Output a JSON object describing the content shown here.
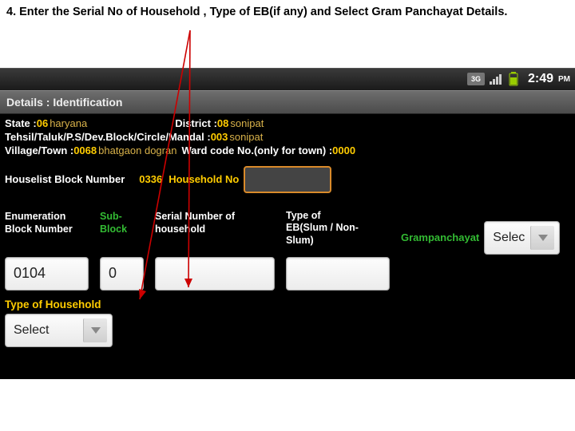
{
  "instruction": "4. Enter the Serial No of Household , Type of EB(if any) and Select Gram Panchayat Details.",
  "status": {
    "time": "2:49",
    "ampm": "PM",
    "net": "3G"
  },
  "title": "Details : Identification",
  "loc": {
    "state_label": "State : ",
    "state_code": "06",
    "state_name": "haryana",
    "district_label": "District : ",
    "district_code": "08",
    "district_name": "sonipat",
    "tehsil_label": "Tehsil/Taluk/P.S/Dev.Block/Circle/Mandal : ",
    "tehsil_code": "003",
    "tehsil_name": "sonipat",
    "village_label": "Village/Town : ",
    "village_code": "0068",
    "village_name": "bhatgaon dogran",
    "ward_label": "Ward code No.(only for town) : ",
    "ward_code": "0000",
    "hlb_label": "Houselist Block Number",
    "hlb_code": "0336",
    "hhno_label": "Household No"
  },
  "cols": {
    "enum_label1": "Enumeration",
    "enum_label2": "Block Number",
    "enum_value": "0104",
    "sub_label1": "Sub-",
    "sub_label2": "Block",
    "sub_value": "0",
    "serial_label1": "Serial Number of",
    "serial_label2": "household",
    "serial_value": "",
    "eb_label1": "Type of",
    "eb_label2": "EB(Slum / Non-",
    "eb_label3": "Slum)",
    "eb_value": "",
    "gram_label": "Grampanchayat",
    "gram_value": "Selec"
  },
  "type_hh_label": "Type of Household",
  "select_label": "Select"
}
